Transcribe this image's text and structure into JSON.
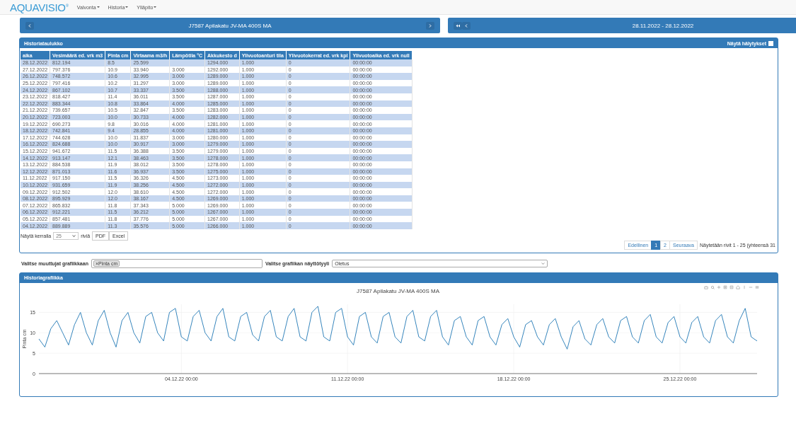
{
  "navbar": {
    "logo": "AQUAVISIO$^{®}$",
    "menus": [
      {
        "label": "Valvonta"
      },
      {
        "label": "Historia"
      },
      {
        "label": "Ylläpito"
      }
    ]
  },
  "site_bar": {
    "title": "J7587 Apilakatu JV-MA 400S MA"
  },
  "period_bar": {
    "title": "28.11.2022 - 28.12.2022"
  },
  "table_panel": {
    "title": "Historiataulukko",
    "alarm_toggle": {
      "label": "Näytä hälytykset",
      "checked": false
    },
    "columns": [
      "aika",
      "Vesimäärä ed. vrk m3",
      "Pinta cm",
      "Virtaama m3/h",
      "Lämpötila °C",
      "Akkukesto d",
      "Ylivuotoanturi tila",
      "Ylivuotokerrat ed. vrk kpl",
      "Ylivuotoaika ed. vrk null"
    ],
    "rows": [
      [
        "28.12.2022",
        "812.194",
        "8.5",
        "25.599",
        "",
        "1294.000",
        "1.000",
        "0",
        "00:00:00"
      ],
      [
        "27.12.2022",
        "797.376",
        "10.9",
        "33.940",
        "3.000",
        "1292.000",
        "1.000",
        "0",
        "00:00:00"
      ],
      [
        "26.12.2022",
        "748.572",
        "10.6",
        "32.995",
        "3.000",
        "1289.000",
        "1.000",
        "0",
        "00:00:00"
      ],
      [
        "25.12.2022",
        "797.416",
        "10.2",
        "31.297",
        "3.000",
        "1289.000",
        "1.000",
        "0",
        "00:00:00"
      ],
      [
        "24.12.2022",
        "867.102",
        "10.7",
        "33.337",
        "3.500",
        "1288.000",
        "1.000",
        "0",
        "00:00:00"
      ],
      [
        "23.12.2022",
        "818.427",
        "11.4",
        "36.011",
        "3.500",
        "1287.000",
        "1.000",
        "0",
        "00:00:00"
      ],
      [
        "22.12.2022",
        "883.344",
        "10.8",
        "33.864",
        "4.000",
        "1285.000",
        "1.000",
        "0",
        "00:00:00"
      ],
      [
        "21.12.2022",
        "739.657",
        "10.5",
        "32.847",
        "3.500",
        "1283.000",
        "1.000",
        "0",
        "00:00:00"
      ],
      [
        "20.12.2022",
        "723.003",
        "10.0",
        "30.733",
        "4.000",
        "1282.000",
        "1.000",
        "0",
        "00:00:00"
      ],
      [
        "19.12.2022",
        "690.273",
        "9.8",
        "30.016",
        "4.000",
        "1281.000",
        "1.000",
        "0",
        "00:00:00"
      ],
      [
        "18.12.2022",
        "742.841",
        "9.4",
        "28.855",
        "4.000",
        "1281.000",
        "1.000",
        "0",
        "00:00:00"
      ],
      [
        "17.12.2022",
        "744.628",
        "10.0",
        "31.837",
        "3.000",
        "1280.000",
        "1.000",
        "0",
        "00:00:00"
      ],
      [
        "16.12.2022",
        "824.688",
        "10.0",
        "30.917",
        "3.000",
        "1279.000",
        "1.000",
        "0",
        "00:00:00"
      ],
      [
        "15.12.2022",
        "941.672",
        "11.5",
        "36.388",
        "3.500",
        "1279.000",
        "1.000",
        "0",
        "00:00:00"
      ],
      [
        "14.12.2022",
        "913.147",
        "12.1",
        "38.463",
        "3.500",
        "1278.000",
        "1.000",
        "0",
        "00:00:00"
      ],
      [
        "13.12.2022",
        "884.538",
        "11.9",
        "38.012",
        "3.500",
        "1278.000",
        "1.000",
        "0",
        "00:00:00"
      ],
      [
        "12.12.2022",
        "871.013",
        "11.6",
        "36.937",
        "3.500",
        "1275.000",
        "1.000",
        "0",
        "00:00:00"
      ],
      [
        "11.12.2022",
        "917.150",
        "11.5",
        "36.326",
        "4.500",
        "1273.000",
        "1.000",
        "0",
        "00:00:00"
      ],
      [
        "10.12.2022",
        "931.659",
        "11.9",
        "38.256",
        "4.500",
        "1272.000",
        "1.000",
        "0",
        "00:00:00"
      ],
      [
        "09.12.2022",
        "912.502",
        "12.0",
        "38.610",
        "4.500",
        "1272.000",
        "1.000",
        "0",
        "00:00:00"
      ],
      [
        "08.12.2022",
        "895.929",
        "12.0",
        "38.167",
        "4.500",
        "1269.000",
        "1.000",
        "0",
        "00:00:00"
      ],
      [
        "07.12.2022",
        "865.832",
        "11.8",
        "37.343",
        "5.000",
        "1269.000",
        "1.000",
        "0",
        "00:00:00"
      ],
      [
        "06.12.2022",
        "912.221",
        "11.5",
        "36.212",
        "5.000",
        "1267.000",
        "1.000",
        "0",
        "00:00:00"
      ],
      [
        "05.12.2022",
        "857.481",
        "11.8",
        "37.776",
        "5.000",
        "1267.000",
        "1.000",
        "0",
        "00:00:00"
      ],
      [
        "04.12.2022",
        "889.889",
        "11.3",
        "35.576",
        "5.000",
        "1266.000",
        "1.000",
        "0",
        "00:00:00"
      ]
    ],
    "page_size": {
      "label": "Näytä kerralla",
      "value": "25",
      "suffix": "riviä"
    },
    "export_buttons": [
      "PDF",
      "Excel"
    ],
    "pagination": [
      {
        "label": "Edellinen",
        "selected": false
      },
      {
        "label": "1",
        "selected": true
      },
      {
        "label": "2",
        "selected": false
      },
      {
        "label": "Seuraava",
        "selected": false
      }
    ],
    "row_info": "Näytetään rivit 1 - 25 (yhteensä 31"
  },
  "chart_options": {
    "variables_label": "Valitse muuttujat grafiikkaan",
    "variables": [
      {
        "remove": "×",
        "label": "Pinta cm"
      }
    ],
    "style_label": "Valitse grafiikan näyttötyyli",
    "style_value": "Oletus"
  },
  "chart_panel": {
    "title": "Historiagrafiikka",
    "chart_data": {
      "type": "line",
      "title": "J7587 Apilakatu JV-MA 400S MA",
      "ylabel": "Pinta cm",
      "ylim": [
        0,
        17
      ],
      "yticks": [
        0,
        5,
        10,
        15
      ],
      "grid": true,
      "categories": [
        null,
        null,
        null,
        null,
        null,
        null,
        null,
        null,
        null,
        null,
        null,
        null,
        null,
        null,
        null,
        null,
        null,
        null,
        null,
        null,
        null,
        null,
        null,
        null,
        "04.12.22 00:00",
        null,
        null,
        null,
        null,
        null,
        null,
        null,
        null,
        null,
        null,
        null,
        null,
        null,
        null,
        null,
        null,
        null,
        null,
        null,
        null,
        null,
        null,
        null,
        null,
        null,
        null,
        null,
        "11.12.22 00:00",
        null,
        null,
        null,
        null,
        null,
        null,
        null,
        null,
        null,
        null,
        null,
        null,
        null,
        null,
        null,
        null,
        null,
        null,
        null,
        null,
        null,
        null,
        null,
        null,
        null,
        null,
        null,
        "18.12.22 00:00",
        null,
        null,
        null,
        null,
        null,
        null,
        null,
        null,
        null,
        null,
        null,
        null,
        null,
        null,
        null,
        null,
        null,
        null,
        null,
        null,
        null,
        null,
        null,
        null,
        null,
        null,
        null,
        "25.12.22 00:00",
        null,
        null,
        null,
        null,
        null,
        null,
        null,
        null,
        null,
        null,
        null,
        null,
        null
      ],
      "values": [
        8.5,
        6.5,
        11,
        13,
        10,
        7,
        12,
        15,
        10,
        7,
        13,
        15.5,
        10,
        6.5,
        13,
        15,
        10,
        7.5,
        14,
        15,
        10,
        8,
        15,
        16,
        9,
        8,
        14,
        15.5,
        10,
        8,
        14,
        16,
        9,
        8,
        14,
        15,
        9.5,
        8,
        14,
        15.5,
        9,
        8,
        14,
        16,
        9,
        8,
        15,
        16.5,
        9,
        8,
        15,
        16,
        9,
        7,
        14,
        15,
        9,
        7.5,
        14,
        15,
        9,
        7.5,
        14,
        15.5,
        9,
        8,
        14,
        15.5,
        9,
        7,
        13,
        14,
        9,
        7,
        13,
        14,
        9,
        7,
        12,
        13.5,
        9,
        6.5,
        12,
        13,
        9,
        7,
        12,
        13.5,
        9,
        6,
        11.5,
        13,
        8.5,
        7,
        12,
        13.5,
        9,
        7.5,
        13,
        14,
        9,
        7.5,
        13,
        14.5,
        9,
        7.5,
        12.5,
        14,
        9,
        7.5,
        12.5,
        14,
        9,
        7.5,
        13,
        14.5,
        9,
        7.5,
        13,
        16,
        9,
        8
      ]
    }
  }
}
